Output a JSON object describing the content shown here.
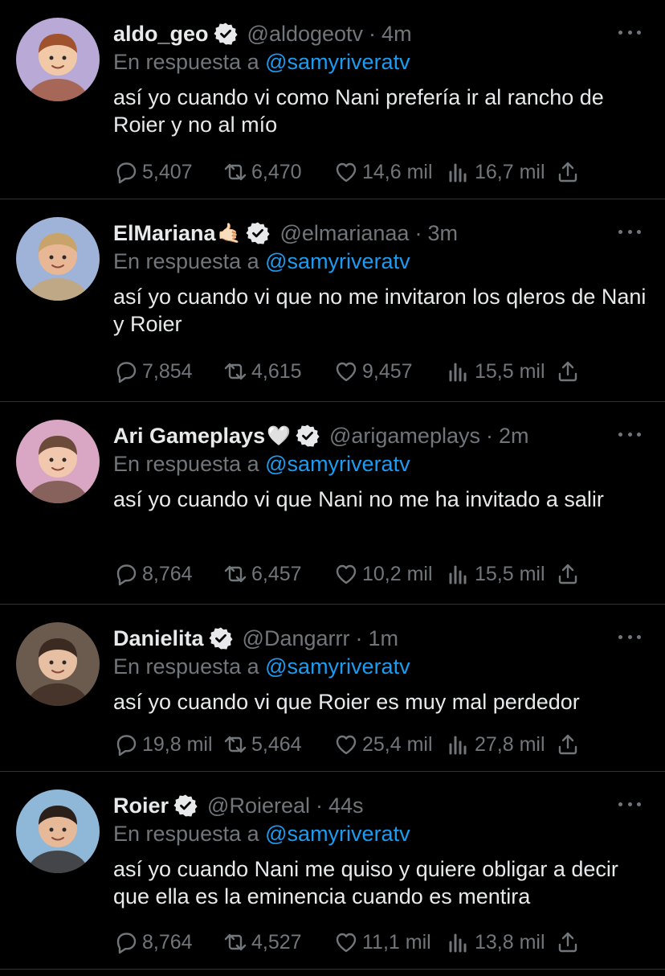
{
  "tweets": [
    {
      "name": "aldo_geo",
      "emoji": "",
      "handle": "@aldogeotv",
      "time": "4m",
      "reply_prefix": "En respuesta a",
      "reply_to": "@samyriveratv",
      "text": "así yo cuando vi como Nani prefería ir al rancho de Roier y no al mío",
      "replies": "5,407",
      "retweets": "6,470",
      "likes": "14,6 mil",
      "views": "16,7 mil",
      "avatar_color": "#b9a9d6"
    },
    {
      "name": "ElMariana",
      "emoji": "🤙🏻",
      "handle": "@elmarianaa",
      "time": "3m",
      "reply_prefix": "En respuesta a",
      "reply_to": "@samyriveratv",
      "text": "así yo cuando vi que no me invitaron los qleros de Nani y Roier",
      "replies": "7,854",
      "retweets": "4,615",
      "likes": "9,457",
      "views": "15,5 mil",
      "avatar_color": "#9fb3d8"
    },
    {
      "name": "Ari Gameplays",
      "emoji": "🤍",
      "handle": "@arigameplays",
      "time": "2m",
      "reply_prefix": "En respuesta a",
      "reply_to": "@samyriveratv",
      "text": "así yo cuando vi que Nani no me ha invitado a salir",
      "replies": "8,764",
      "retweets": "6,457",
      "likes": "10,2 mil",
      "views": "15,5 mil",
      "avatar_color": "#d9a6c4"
    },
    {
      "name": "Danielita",
      "emoji": "",
      "handle": "@Dangarrr",
      "time": "1m",
      "reply_prefix": "En respuesta a",
      "reply_to": "@samyriveratv",
      "text": "así yo cuando vi que Roier es muy mal perdedor",
      "replies": "19,8 mil",
      "retweets": "5,464",
      "likes": "25,4 mil",
      "views": "27,8 mil",
      "avatar_color": "#6b5a4e"
    },
    {
      "name": "Roier",
      "emoji": "",
      "handle": "@Roiereal",
      "time": "44s",
      "reply_prefix": "En respuesta a",
      "reply_to": "@samyriveratv",
      "text": "así yo cuando Nani me quiso y quiere obligar a decir que ella es la eminencia cuando es mentira",
      "replies": "8,764",
      "retweets": "4,527",
      "likes": "11,1 mil",
      "views": "13,8 mil",
      "avatar_color": "#8fb8d8"
    }
  ],
  "colors": {
    "background": "#000000",
    "text": "#e7e9ea",
    "muted": "#71767b",
    "link": "#1d9bf0",
    "divider": "#2f3336"
  },
  "icons": [
    "reply-icon",
    "retweet-icon",
    "like-icon",
    "views-icon",
    "share-icon",
    "more-icon",
    "verified-badge-icon"
  ]
}
